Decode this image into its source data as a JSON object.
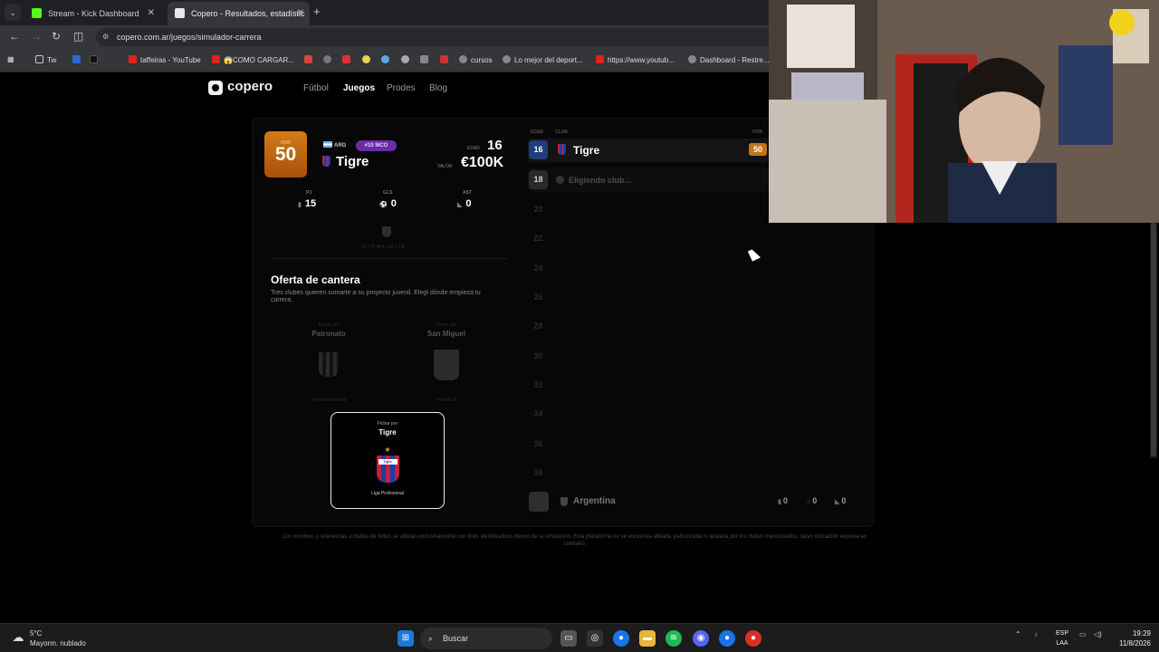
{
  "browser": {
    "tabs": [
      {
        "title": "Stream - Kick Dashboard",
        "color": "#53fc18"
      },
      {
        "title": "Copero - Resultados, estadístic",
        "color": "#e7e7e7"
      }
    ],
    "url": "copero.com.ar/juegos/simulador-carrera",
    "bookmarks": [
      {
        "label": "Tw",
        "icon": "folder-icon"
      },
      {
        "label": "",
        "icon": "paypal-icon"
      },
      {
        "label": "",
        "icon": "tiktok-icon"
      },
      {
        "label": "taffeiras - YouTube",
        "icon": "youtube-icon"
      },
      {
        "label": "😱COMO CARGAR...",
        "icon": "youtube-icon"
      },
      {
        "label": "",
        "icon": "gmail-icon"
      },
      {
        "label": "cursos",
        "icon": "globe-icon"
      },
      {
        "label": "Lo mejor del deport...",
        "icon": "globe-icon"
      },
      {
        "label": "https://www.youtub...",
        "icon": "youtube-icon"
      },
      {
        "label": "Dashboard - Restre...",
        "icon": "globe-icon"
      }
    ]
  },
  "site": {
    "logo": "copero",
    "nav": [
      "Fútbol",
      "Juegos",
      "Prodes",
      "Blog"
    ],
    "active_nav": "Juegos"
  },
  "player": {
    "ovr_label": "OVR",
    "ovr": "50",
    "nation": "ARG",
    "position": "#10 MCO",
    "club": "Tigre",
    "age_label": "EDAD",
    "age": "16",
    "value_label": "VALOR",
    "value": "€100K",
    "stats": [
      {
        "label": "PJ",
        "value": "15"
      },
      {
        "label": "GLS",
        "value": "0"
      },
      {
        "label": "AST",
        "value": "0"
      }
    ],
    "showcase": "VITRINA VACÍA"
  },
  "offer": {
    "title": "Oferta de cantera",
    "subtitle": "Tres clubes quieren sumarte a su proyecto juvenil. Elegí dónde empieza tu carrera.",
    "options": [
      {
        "header": "Fichar por",
        "club": "Patronato",
        "league": "Primera Nacional"
      },
      {
        "header": "Fichar por",
        "club": "San Miguel",
        "league": "Primera B"
      },
      {
        "header": "Fichar por",
        "club": "Tigre",
        "league": "Liga Profesional"
      }
    ]
  },
  "timeline": {
    "headers": {
      "age": "EDAD",
      "club": "CLUB",
      "ovr": "OVR"
    },
    "current": {
      "age": "16",
      "club": "Tigre",
      "ovr": "50"
    },
    "next": {
      "age": "18",
      "status": "Eligiendo club..."
    },
    "future_ages": [
      "20",
      "22",
      "24",
      "26",
      "28",
      "30",
      "32",
      "34",
      "36",
      "38"
    ],
    "national": {
      "name": "Argentina",
      "stats": [
        "0",
        "0",
        "0"
      ]
    }
  },
  "disclaimer": "Los nombres y referencias a clubes de fútbol se utilizan exclusivamente con fines identificativos dentro de la simulación. Esta plataforma no se encuentra afiliada, patrocinada ni avalada por los clubes mencionados, salvo indicación expresa en contrario.",
  "taskbar": {
    "temp": "5°C",
    "weather": "Mayorm. nublado",
    "search": "Buscar",
    "lang1": "ESP",
    "lang2": "LAA",
    "time": "19:29",
    "date": "11/8/2026"
  },
  "colors": {
    "ovr_accent": "#d27a1a",
    "position_badge": "#6a2ca8"
  }
}
